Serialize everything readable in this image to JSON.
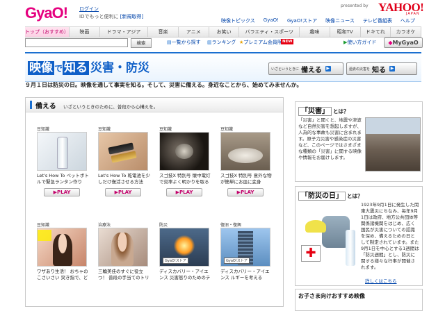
{
  "header": {
    "logo": "GyaO!",
    "login": "ログイン",
    "tagline": "IDでもっと便利に",
    "register": "[新規取得]",
    "presented_by": "presented by",
    "yahoo_logo": "YAHOO!",
    "yahoo_japan": "JAPAN",
    "top_links": [
      "映像トピックス",
      "GyaO!",
      "GyaO!ストア",
      "映像ニュース",
      "テレビ番組表",
      "ヘルプ"
    ]
  },
  "nav": {
    "tabs": [
      "トップ（おすすめ）",
      "映画",
      "ドラマ・アジア",
      "音楽",
      "アニメ",
      "お笑い",
      "バラエティ・スポーツ",
      "趣味",
      "昭和TV",
      "ドキてれ",
      "カラオケ"
    ],
    "active_index": 0
  },
  "search": {
    "input_value": "",
    "button_label": "検索",
    "links": [
      "一覧から探す",
      "ランキング",
      "プレミアム会員限定"
    ],
    "new_badge": "NEW",
    "guide": "使い方ガイド",
    "mygyao": "MyGyaO"
  },
  "banner": {
    "title_parts": [
      "映像",
      "で",
      "知る",
      "災害・防災"
    ],
    "button1": {
      "small": "いざというときに",
      "big": "備える"
    },
    "button2": {
      "small": "過去の災害を",
      "big": "知る"
    }
  },
  "subhead": "９月１日は防災の日。映像を通して事実を知る。そして、災害に備える。身近なことから、始めてみませんか。",
  "section": {
    "title": "備える",
    "description": "いざというときのために、普段から心構えを。",
    "cards": [
      {
        "category": "豆知識",
        "title": "Let's How To ペットボトルで緊急ランタン作り",
        "play": "PLAY"
      },
      {
        "category": "豆知識",
        "title": "Let's How To 乾電池を少しだけ復活させる方法",
        "play": "PLAY"
      },
      {
        "category": "豆知識",
        "title": "スゴ技X 特別号 懐中電灯で効率よく明かりを取る方法",
        "play": "PLAY"
      },
      {
        "category": "豆知識",
        "title": "スゴ技X 特別号 意外な物が簡単にお皿に変身",
        "play": "PLAY"
      },
      {
        "category": "豆知識",
        "title": "ワザあり生活！ おちゃのこさいさい 突き指で、どこでも重宝",
        "tag": ""
      },
      {
        "category": "治療法",
        "title": "三輪美佳のすぐに役立つ！ 普段の手当てのトリ必要はけがや改善方法",
        "tag": ""
      },
      {
        "category": "防災",
        "title": "ディスカバリー・アイエンス 災害怒りのためのテクノロジー",
        "tag": "GyaO!ストア"
      },
      {
        "category": "復旧・復興",
        "title": "ディスカバリー・アイエンス ルギーを考える",
        "tag": "GyaO!ストア"
      }
    ]
  },
  "right": {
    "box1": {
      "title": "「災害」",
      "suffix": "とは？",
      "text": "「災害」と聞くと、地震や津波など自然災害を想起しますが、人為的な事故も災害に含まれます。原子力災害や感染症の災害など、このページではさまざまな種類の「災害」に関する映像や情報をお届けします。"
    },
    "box2": {
      "title": "「防災の日」",
      "suffix": "とは？",
      "text": "1923年9月1日に発生した関東大震災にちなみ、毎年9月1日は政府、地方公共団体等関係諸機関をはじめ、広く国民が災害についての認識を深め、備えるための日として制定されています。また9月1日を中心とする1週間は「防災週間」とし、防災に関する様々な行事が開催されます。",
      "link": "詳しくはこちら"
    },
    "box3": {
      "title": "お子さま向けおすすめ映像"
    }
  }
}
